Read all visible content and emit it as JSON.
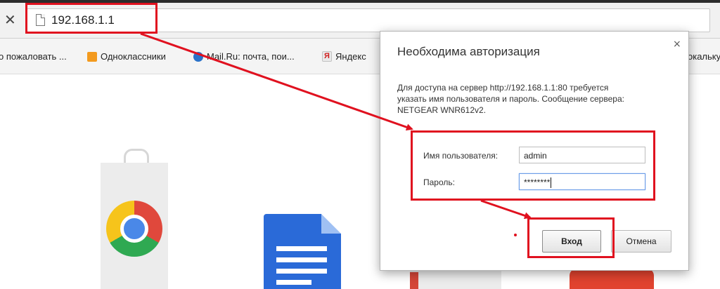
{
  "browser": {
    "stop_symbol": "✕",
    "url": "192.168.1.1"
  },
  "bookmarks": [
    {
      "label": "о пожаловать ...",
      "icon": "none"
    },
    {
      "label": "Одноклассники",
      "icon": "odnoklassniki-icon"
    },
    {
      "label": "Mail.Ru: почта, пои...",
      "icon": "mailru-icon"
    },
    {
      "label": "Яндекс",
      "icon": "yandex-icon"
    },
    {
      "label": "окальку",
      "icon": "none"
    }
  ],
  "auth_dialog": {
    "title": "Необходима авторизация",
    "close_symbol": "×",
    "message_lines": [
      "Для доступа на сервер http://192.168.1.1:80 требуется",
      "указать имя пользователя и пароль. Сообщение сервера:",
      "NETGEAR WNR612v2."
    ],
    "username_label": "Имя пользователя:",
    "username_value": "admin",
    "password_label": "Пароль:",
    "password_value": "********",
    "login_button": "Вход",
    "cancel_button": "Отмена"
  },
  "colors": {
    "annotation": "#e0111f",
    "focus_border": "#6d9ee8"
  },
  "apps": [
    "chrome-web-store-icon",
    "google-docs-icon",
    "gmail-icon",
    "youtube-icon"
  ]
}
